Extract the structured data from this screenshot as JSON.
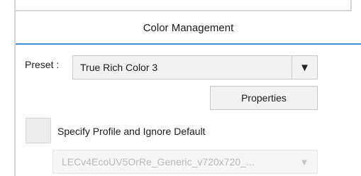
{
  "section": {
    "title": "Color Management",
    "accent_color": "#4a8fd6"
  },
  "preset": {
    "label": "Preset :",
    "selected_value": "True Rich Color 3",
    "arrow_glyph": "▼"
  },
  "properties_button": {
    "label": "Properties"
  },
  "specify_profile": {
    "label": "Specify Profile and Ignore Default",
    "checked": false
  },
  "profile": {
    "selected_value": "LECv4EcoUV5OrRe_Generic_v720x720_...",
    "arrow_glyph": "▼",
    "disabled": true
  }
}
